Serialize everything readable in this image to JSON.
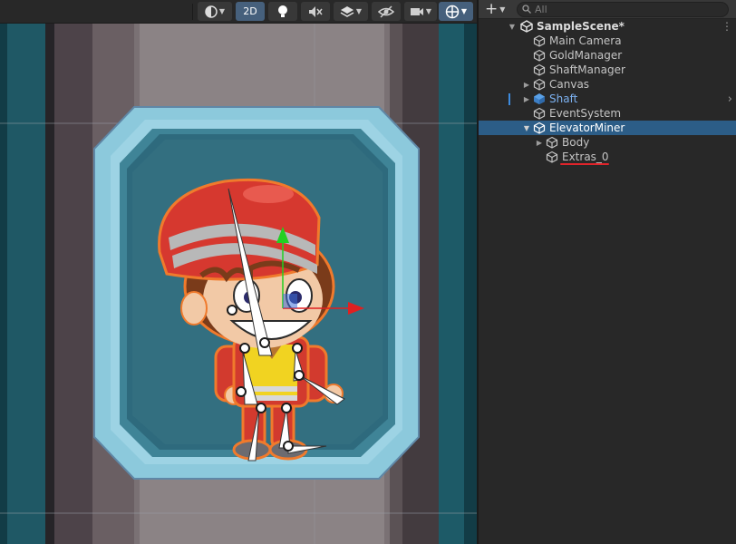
{
  "scene_toolbar": {
    "two_d_label": "2D"
  },
  "hierarchy": {
    "search": {
      "placeholder": "All",
      "value": ""
    },
    "add_icon": "plus-icon",
    "scene_name": "SampleScene*",
    "items": [
      {
        "label": "Main Camera",
        "depth": 1,
        "expandable": false
      },
      {
        "label": "GoldManager",
        "depth": 1,
        "expandable": false
      },
      {
        "label": "ShaftManager",
        "depth": 1,
        "expandable": false
      },
      {
        "label": "Canvas",
        "depth": 1,
        "expandable": true,
        "expanded": false
      },
      {
        "label": "Shaft",
        "depth": 1,
        "expandable": true,
        "expanded": false,
        "prefab": true
      },
      {
        "label": "EventSystem",
        "depth": 1,
        "expandable": false
      },
      {
        "label": "ElevatorMiner",
        "depth": 1,
        "expandable": true,
        "expanded": true,
        "selected": true
      },
      {
        "label": "Body",
        "depth": 2,
        "expandable": true,
        "expanded": false
      },
      {
        "label": "Extras_0",
        "depth": 2,
        "expandable": false,
        "annotated": true
      }
    ]
  },
  "colors": {
    "selection": "#2c5d87",
    "prefab_text": "#7cb1f0",
    "annotation_underline": "#e0242b",
    "gizmo_x": "#e02020",
    "gizmo_y": "#22d022"
  }
}
